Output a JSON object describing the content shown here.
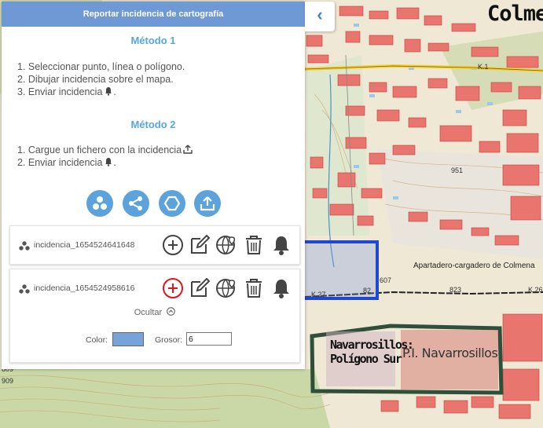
{
  "panel": {
    "title": "Reportar incidencia de cartografía",
    "collapse_glyph": "‹"
  },
  "method1": {
    "title": "Método 1",
    "steps": [
      "1. Seleccionar punto, línea o polígono.",
      "2. Dibujar incidencia sobre el mapa.",
      "3. Enviar incidencia"
    ]
  },
  "method2": {
    "title": "Método 2",
    "steps": [
      "1. Cargue un fichero con la incidencia",
      "2. Enviar incidencia"
    ]
  },
  "tools": [
    {
      "name": "point-tool",
      "icon": "dots-icon"
    },
    {
      "name": "line-tool",
      "icon": "share-icon"
    },
    {
      "name": "polygon-tool",
      "icon": "hexagon-icon"
    },
    {
      "name": "upload-tool",
      "icon": "upload-icon"
    }
  ],
  "incidents": [
    {
      "name": "incidencia_1654524641648",
      "add_active": false
    },
    {
      "name": "incidencia_1654524958616",
      "add_active": true
    }
  ],
  "incident_options": {
    "hide_label": "Ocultar",
    "color_label": "Color:",
    "color_value": "#76a3d8",
    "width_label": "Grosor:",
    "width_value": "6"
  },
  "map": {
    "town_label": "Colme",
    "apt_label": "Apartadero-cargadero de Colmena",
    "navarrosillos_line1": "Navarrosillos:",
    "navarrosillos_line2": "Polígono Sur",
    "pi_label": "P.I. Navarrosillos",
    "labels": [
      "K.1",
      "951",
      "607",
      "82",
      "823",
      "K.26",
      "K.27",
      "909",
      "809"
    ]
  },
  "colors": {
    "accent": "#5ba3da",
    "header": "#6f99d4",
    "active_add": "#e3141b"
  }
}
